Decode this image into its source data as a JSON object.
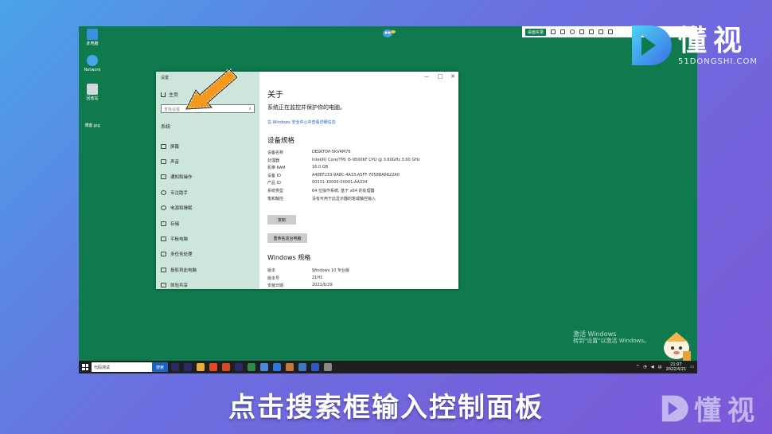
{
  "desktop": {
    "icons": [
      {
        "label": "此电脑",
        "color": "#3b8fe0"
      },
      {
        "label": "Network",
        "color": "#4aa7e6"
      },
      {
        "label": "回收站",
        "color": "#cfd8dc"
      },
      {
        "label": "博客.jpg",
        "color": "#0f7a4e"
      }
    ],
    "topbar_label": "桌面实录",
    "activate_line1": "激活 Windows",
    "activate_line2": "转到\"设置\"以激活 Windows。"
  },
  "window": {
    "title": "设置",
    "controls": {
      "minimize": "—",
      "maximize": "□",
      "close": "✕"
    },
    "home_label": "主页",
    "search_placeholder": "查找设置",
    "section_label": "系统",
    "nav_items": [
      "屏幕",
      "声音",
      "通知和操作",
      "专注助手",
      "电源和睡眠",
      "存储",
      "平板电脑",
      "多任务处理",
      "投影到此电脑",
      "体验共享"
    ],
    "about_title": "关于",
    "about_sub": "系统正在监控并保护你的电脑。",
    "about_link": "在 Windows 安全中心中查看详细信息",
    "spec_title": "设备规格",
    "specs": [
      {
        "k": "设备名称",
        "v": "DESKTOP-5KV4M76"
      },
      {
        "k": "处理器",
        "v": "Intel(R) Core(TM) i5-9500KF CPU @ 3.60GHz   3.60 GHz"
      },
      {
        "k": "机带 RAM",
        "v": "16.0 GB"
      },
      {
        "k": "设备 ID",
        "v": "A48EF233-9A8C-4A33-A5FF-7058BA6622A0"
      },
      {
        "k": "产品 ID",
        "v": "00331-10000-00001-AA334"
      },
      {
        "k": "系统类型",
        "v": "64 位操作系统, 基于 x64 的处理器"
      },
      {
        "k": "笔和触控",
        "v": "没有可用于此显示器的笔或触控输入"
      }
    ],
    "copy_button": "复制",
    "rename_button": "重命名这台电脑",
    "win_spec_title": "Windows 规格",
    "win_specs": [
      {
        "k": "版本",
        "v": "Windows 10 专业版"
      },
      {
        "k": "版本号",
        "v": "21H1"
      },
      {
        "k": "安装日期",
        "v": "2021/6/29"
      }
    ]
  },
  "taskbar": {
    "search_text": "代码测试",
    "search_button": "搜索",
    "apps": [
      "#2a2a6a",
      "#2a2a6a",
      "#e8b03a",
      "#e04a2a",
      "#d64a2a",
      "#2a2a6a",
      "#2a8a4a",
      "#4a8ae0",
      "#2a7ae0",
      "#c27a3a",
      "#3a7ac2",
      "#2a5ac2",
      "#888888"
    ],
    "tray_lang": "中",
    "clock_time": "21:07",
    "clock_date": "2022/4/21"
  },
  "brand": {
    "name_cn": "懂视",
    "name_en": "51DONGSHI.COM"
  },
  "caption": "点击搜索框输入控制面板"
}
